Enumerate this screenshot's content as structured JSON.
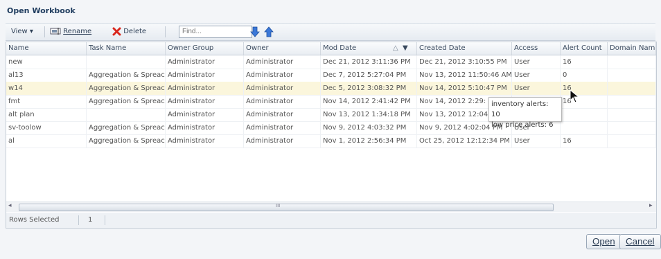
{
  "dialog": {
    "title": "Open Workbook"
  },
  "toolbar": {
    "view_label": "View ▾",
    "rename_label": "Rename",
    "delete_label": "Delete",
    "find_placeholder": "Find...",
    "move_down_icon": "arrow-down-icon",
    "move_up_icon": "arrow-up-icon"
  },
  "table": {
    "columns": [
      "Name",
      "Task Name",
      "Owner Group",
      "Owner",
      "Mod Date",
      "Created Date",
      "Access",
      "Alert Count",
      "Domain Name"
    ],
    "rows": [
      [
        "new",
        "",
        "Administrator",
        "Administrator",
        "Dec 21, 2012 3:11:36 PM",
        "Dec 21, 2012 3:10:55 PM",
        "User",
        "16",
        ""
      ],
      [
        "al13",
        "Aggregation & Spreac",
        "Administrator",
        "Administrator",
        "Dec 7, 2012 5:27:04 PM",
        "Nov 13, 2012 11:50:46 AM",
        "User",
        "0",
        ""
      ],
      [
        "w14",
        "Aggregation & Spreac",
        "Administrator",
        "Administrator",
        "Dec 5, 2012 3:08:32 PM",
        "Nov 14, 2012 5:10:47 PM",
        "User",
        "16",
        ""
      ],
      [
        "fmt",
        "Aggregation & Spreac",
        "Administrator",
        "Administrator",
        "Nov 14, 2012 2:41:42 PM",
        "Nov 14, 2012 2:29:",
        "",
        "16",
        ""
      ],
      [
        "alt plan",
        "",
        "Administrator",
        "Administrator",
        "Nov 13, 2012 1:34:18 PM",
        "Nov 13, 2012 12:04",
        "",
        "",
        ""
      ],
      [
        "sv-toolow",
        "Aggregation & Spreac",
        "Administrator",
        "Administrator",
        "Nov 9, 2012 4:03:32 PM",
        "Nov 9, 2012 4:02:04 PM",
        "User",
        "",
        ""
      ],
      [
        "al",
        "Aggregation & Spreac",
        "Administrator",
        "Administrator",
        "Nov 1, 2012 2:56:34 PM",
        "Oct 25, 2012 12:12:34 PM",
        "User",
        "16",
        ""
      ]
    ],
    "selected_row": 2,
    "scrollbar_center": "III"
  },
  "tooltip": {
    "line1": "inventory alerts: 10",
    "line2": "low price alerts: 6"
  },
  "status": {
    "rows_selected_label": "Rows Selected",
    "rows_selected_value": "1"
  },
  "buttons": {
    "open_label": "Open",
    "cancel_label": "Cancel"
  },
  "colors": {
    "title": "#1f3c5e",
    "selected_row": "#fbf6dc",
    "delete_x": "#d9261c",
    "arrow": "#3b78d8"
  }
}
